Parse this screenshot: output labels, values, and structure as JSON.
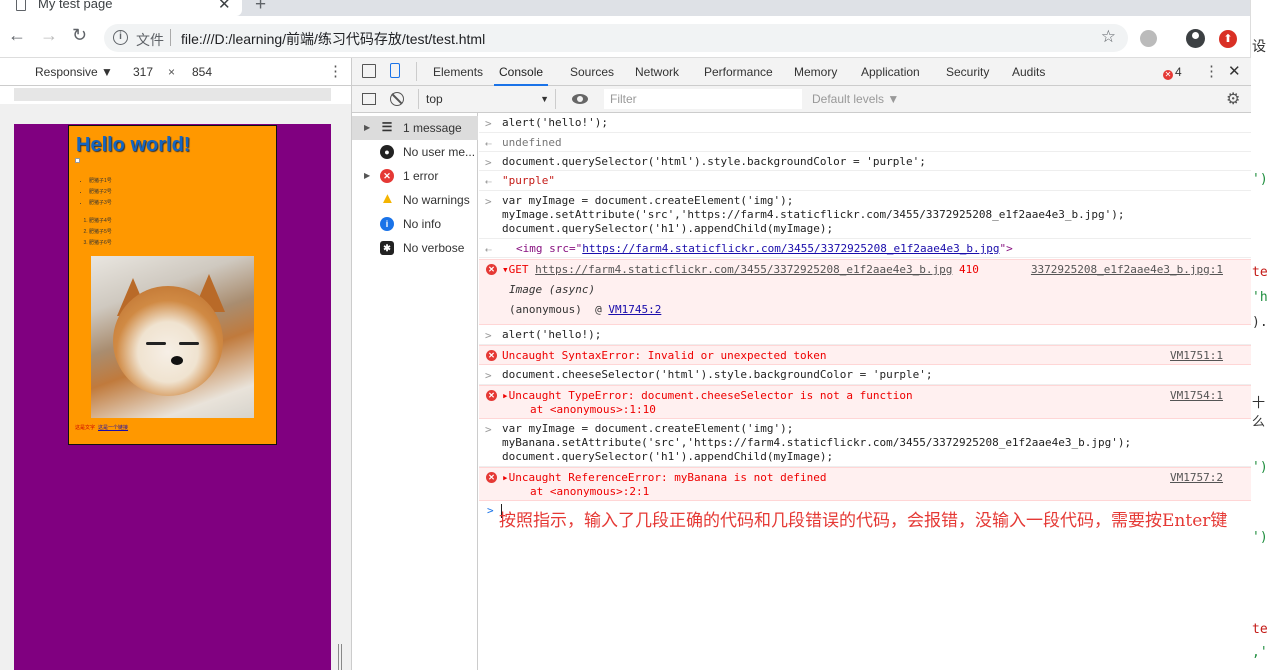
{
  "tab": {
    "title": "My test page",
    "close": "✕",
    "new": "+"
  },
  "toolbar": {
    "back": "←",
    "forward": "→",
    "reload": "↻",
    "scheme_label": "文件",
    "url": "file:///D:/learning/前端/练习代码存放/test/test.html",
    "star": "☆"
  },
  "device_toolbar": {
    "mode": "Responsive ▼",
    "width": "317",
    "times": "×",
    "height": "854",
    "more": "⋮"
  },
  "preview": {
    "heading": "Hello world!",
    "ul_items": [
      "肥猪子1号",
      "肥猪子2号",
      "肥猪子3号"
    ],
    "ol_items": [
      "肥猪子4号",
      "肥猪子5号",
      "肥猪子6号"
    ],
    "footer_text": "这是文字",
    "footer_link": "这是一个链接"
  },
  "devtools": {
    "tabs": [
      "Elements",
      "Console",
      "Sources",
      "Network",
      "Performance",
      "Memory",
      "Application",
      "Security",
      "Audits"
    ],
    "active_tab": "Console",
    "error_count": "4",
    "more": "⋮",
    "close": "✕"
  },
  "console_bar": {
    "context": "top",
    "filter_placeholder": "Filter",
    "levels": "Default levels ▼",
    "gear": "⚙"
  },
  "sidebar": [
    {
      "label": "1 message",
      "icon": "list-icon",
      "expandable": true
    },
    {
      "label": "No user me...",
      "icon": "user-icon",
      "expandable": false
    },
    {
      "label": "1 error",
      "icon": "error-icon",
      "expandable": true
    },
    {
      "label": "No warnings",
      "icon": "warning-icon",
      "expandable": false
    },
    {
      "label": "No info",
      "icon": "info-icon",
      "expandable": false
    },
    {
      "label": "No verbose",
      "icon": "bug-icon",
      "expandable": false
    }
  ],
  "console": {
    "r1_in": "alert('hello!');",
    "r1_out": "undefined",
    "r2_in": "document.querySelector('html').style.backgroundColor = 'purple';",
    "r2_out": "\"purple\"",
    "r3_in_1": "var myImage = document.createElement('img');",
    "r3_in_2": "myImage.setAttribute('src','https://farm4.staticflickr.com/3455/3372925208_e1f2aae4e3_b.jpg');",
    "r3_in_3": "document.querySelector('h1').appendChild(myImage);",
    "r3_out_pre": "<img src=\"",
    "r3_out_link": "https://farm4.staticflickr.com/3455/3372925208_e1f2aae4e3_b.jpg",
    "r3_out_post": "\">",
    "e1_get": "GET",
    "e1_url": "https://farm4.staticflickr.com/3455/3372925208_e1f2aae4e3_b.jpg",
    "e1_code": "410",
    "e1_src": "3372925208_e1f2aae4e3_b.jpg:1",
    "e1_async": "Image (async)",
    "e1_anon": "(anonymous)",
    "e1_at": "@",
    "e1_vm": "VM1745:2",
    "r4_in": "alert('hello!);",
    "e2_msg": "Uncaught SyntaxError: Invalid or unexpected token",
    "e2_src": "VM1751:1",
    "r5_in": "document.cheeseSelector('html').style.backgroundColor = 'purple';",
    "e3_msg": "Uncaught TypeError: document.cheeseSelector is not a function",
    "e3_at": "at <anonymous>:1:10",
    "e3_src": "VM1754:1",
    "r6_in_1": "var myImage = document.createElement('img');",
    "r6_in_2": "myBanana.setAttribute('src','https://farm4.staticflickr.com/3455/3372925208_e1f2aae4e3_b.jpg');",
    "r6_in_3": "document.querySelector('h1').appendChild(myImage);",
    "e4_msg": "Uncaught ReferenceError: myBanana is not defined",
    "e4_at": "at <anonymous>:2:1",
    "e4_src": "VM1757:2",
    "annotation": "按照指示，输入了几段正确的代码和几段错误的代码，会报错，没输入一段代码，需要按Enter键"
  },
  "bg_window": [
    "设",
    "')",
    "te",
    "'h",
    ").",
    "十么",
    "')",
    "')",
    "te",
    ",'"
  ]
}
